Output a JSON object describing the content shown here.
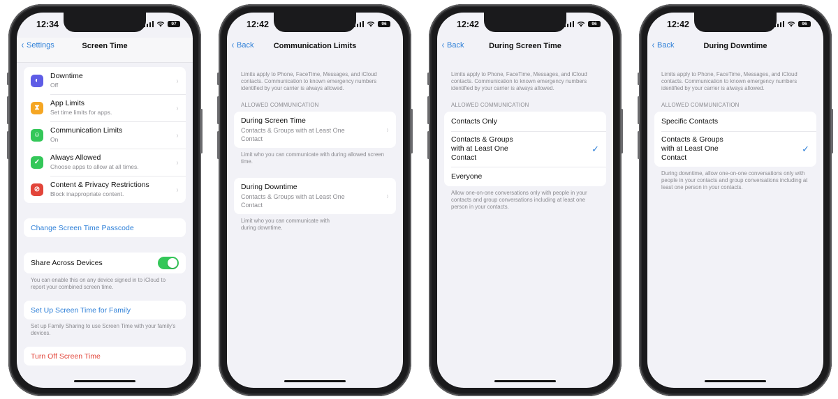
{
  "colors": {
    "accent": "#2f80d8",
    "danger": "#e2453a",
    "toggle_on": "#34c759",
    "downtime_icon": "#5e5ce6",
    "app_limits_icon": "#f5a623",
    "communication_icon": "#34c759",
    "always_allowed_icon": "#34c759",
    "content_restrictions_icon": "#e2453a"
  },
  "phones": [
    {
      "status": {
        "time": "12:34",
        "battery": "97"
      },
      "nav": {
        "back_label": "Settings",
        "title": "Screen Time"
      },
      "menu": [
        {
          "title": "Downtime",
          "subtitle": "Off",
          "icon": "downtime-icon",
          "glyph": "◐"
        },
        {
          "title": "App Limits",
          "subtitle": "Set time limits for apps.",
          "icon": "hourglass-icon",
          "glyph": "⧗"
        },
        {
          "title": "Communication Limits",
          "subtitle": "On",
          "icon": "person-circle-icon",
          "glyph": "☺"
        },
        {
          "title": "Always Allowed",
          "subtitle": "Choose apps to allow at all times.",
          "icon": "checkmark-shield-icon",
          "glyph": "✓"
        },
        {
          "title": "Content & Privacy Restrictions",
          "subtitle": "Block inappropriate content.",
          "icon": "no-entry-icon",
          "glyph": "⊘"
        }
      ],
      "change_passcode": "Change Screen Time Passcode",
      "share_across_devices": {
        "label": "Share Across Devices",
        "enabled": true,
        "footnote": "You can enable this on any device signed in to iCloud to report your combined screen time."
      },
      "family": {
        "label": "Set Up Screen Time for Family",
        "footnote": "Set up Family Sharing to use Screen Time with your family's devices."
      },
      "turn_off": "Turn Off Screen Time"
    },
    {
      "status": {
        "time": "12:42",
        "battery": "96"
      },
      "nav": {
        "back_label": "Back",
        "title": "Communication Limits"
      },
      "intro": "Limits apply to Phone, FaceTime, Messages, and iCloud contacts. Communication to known emergency numbers identified by your carrier is always allowed.",
      "section_header": "ALLOWED COMMUNICATION",
      "during_screen_time": {
        "title": "During Screen Time",
        "value": "Contacts & Groups with at Least One Contact",
        "footnote": "Limit who you can communicate with during allowed screen time."
      },
      "during_downtime": {
        "title": "During Downtime",
        "value": "Contacts & Groups with at Least One Contact",
        "footnote": "Limit who you can communicate with during downtime."
      }
    },
    {
      "status": {
        "time": "12:42",
        "battery": "96"
      },
      "nav": {
        "back_label": "Back",
        "title": "During Screen Time"
      },
      "intro": "Limits apply to Phone, FaceTime, Messages, and iCloud contacts. Communication to known emergency numbers identified by your carrier is always allowed.",
      "section_header": "ALLOWED COMMUNICATION",
      "options": [
        {
          "label": "Contacts Only",
          "selected": false
        },
        {
          "label": "Contacts & Groups with at Least One Contact",
          "selected": true
        },
        {
          "label": "Everyone",
          "selected": false
        }
      ],
      "footnote": "Allow one-on-one conversations only with people in your contacts and group conversations including at least one person in your contacts."
    },
    {
      "status": {
        "time": "12:42",
        "battery": "96"
      },
      "nav": {
        "back_label": "Back",
        "title": "During Downtime"
      },
      "intro": "Limits apply to Phone, FaceTime, Messages, and iCloud contacts. Communication to known emergency numbers identified by your carrier is always allowed.",
      "section_header": "ALLOWED COMMUNICATION",
      "options": [
        {
          "label": "Specific Contacts",
          "selected": false
        },
        {
          "label": "Contacts & Groups with at Least One Contact",
          "selected": true
        }
      ],
      "footnote": "During downtime, allow one-on-one conversations only with people in your contacts and group conversations including at least one person in your contacts."
    }
  ],
  "glyphs": {
    "back_chevron": "‹",
    "row_chevron": "›",
    "checkmark": "✓"
  }
}
